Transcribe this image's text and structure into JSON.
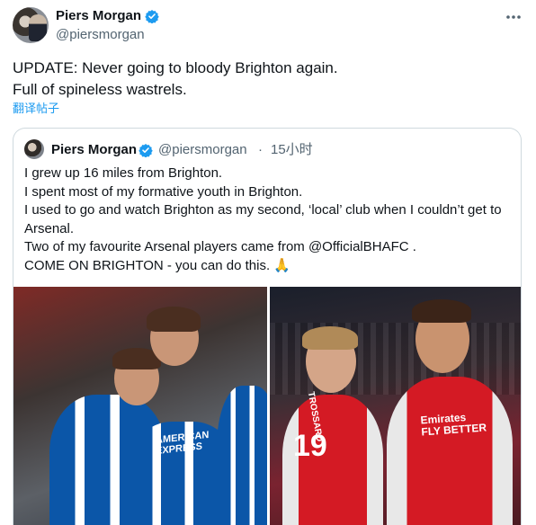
{
  "tweet": {
    "author_name": "Piers Morgan",
    "handle": "@piersmorgan",
    "text": "UPDATE: Never going to bloody Brighton again.\nFull of spineless wastrels.",
    "translate_label": "翻译帖子"
  },
  "quoted_tweet": {
    "author_name": "Piers Morgan",
    "handle": "@piersmorgan",
    "separator": "·",
    "time": "15小时",
    "text": "I grew up 16 miles from Brighton.\nI spent most of my formative youth in Brighton.\nI used to go and watch Brighton as my second, ‘local’ club when I couldn’t get to Arsenal.\nTwo of my favourite Arsenal players came from @OfficialBHAFC .\nCOME ON BRIGHTON - you can do this. 🙏"
  },
  "media": {
    "left_photo": {
      "sponsor_text": "AMERICAN\nEXPRESS"
    },
    "right_photo": {
      "shirt_number": "19",
      "sponsor_text": "Emirates\nFLY BETTER",
      "name_text": "TROSSARD"
    }
  },
  "colors": {
    "verified": "#1d9bf0",
    "link": "#1d9bf0",
    "muted": "#536471",
    "border": "#cfd9de"
  },
  "icons": [
    "more-icon",
    "verified-badge-icon"
  ]
}
